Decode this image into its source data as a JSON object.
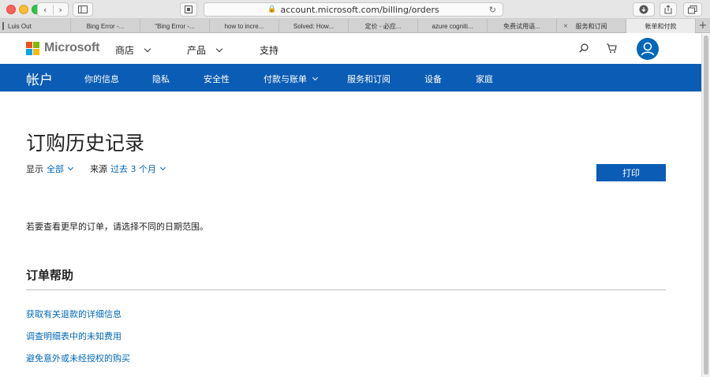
{
  "browser": {
    "url": "account.microsoft.com/billing/orders",
    "tabs": [
      {
        "title": "Luis Out",
        "active": false
      },
      {
        "title": "Bing Error -...",
        "active": false
      },
      {
        "title": "\"Bing Error -...",
        "active": false
      },
      {
        "title": "how to incre...",
        "active": false
      },
      {
        "title": "Solved: How...",
        "active": false
      },
      {
        "title": "定价 - 必应...",
        "active": false
      },
      {
        "title": "azure cogniti...",
        "active": false
      },
      {
        "title": "免费试用语...",
        "active": false
      },
      {
        "title": "服务和订阅",
        "active": false
      },
      {
        "title": "帐单和付款",
        "active": true
      }
    ],
    "new_tab": "+"
  },
  "header": {
    "brand": "Microsoft",
    "nav": [
      {
        "label": "商店",
        "has_dropdown": true
      },
      {
        "label": "产品",
        "has_dropdown": true
      },
      {
        "label": "支持",
        "has_dropdown": false
      }
    ]
  },
  "account_nav": {
    "title": "帐户",
    "items": [
      {
        "label": "你的信息",
        "has_dropdown": false
      },
      {
        "label": "隐私",
        "has_dropdown": false
      },
      {
        "label": "安全性",
        "has_dropdown": false
      },
      {
        "label": "付款与账单",
        "has_dropdown": true
      },
      {
        "label": "服务和订阅",
        "has_dropdown": false
      },
      {
        "label": "设备",
        "has_dropdown": false
      },
      {
        "label": "家庭",
        "has_dropdown": false
      }
    ],
    "background": "#0b5cb4"
  },
  "main": {
    "title": "订购历史记录",
    "filter_show_label": "显示",
    "filter_show_value": "全部",
    "filter_source_label": "来源",
    "filter_source_value": "过去 3 个月",
    "print_label": "打印",
    "info": "若要查看更早的订单，请选择不同的日期范围。",
    "help_title": "订单帮助",
    "help_links": [
      "获取有关退款的详细信息",
      "调查明细表中的未知费用",
      "避免意外或未经授权的购买"
    ]
  },
  "colors": {
    "accent": "#0067b8",
    "nav_blue": "#0b5cb4"
  }
}
